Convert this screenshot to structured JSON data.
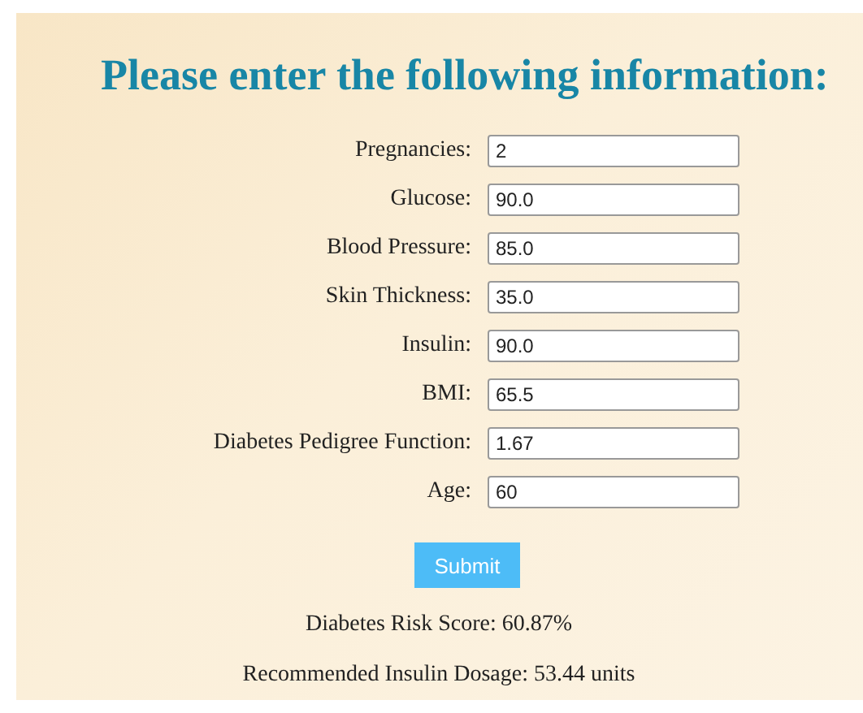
{
  "heading": "Please enter the following information:",
  "fields": [
    {
      "label": "Pregnancies:",
      "value": "2"
    },
    {
      "label": "Glucose:",
      "value": "90.0"
    },
    {
      "label": "Blood Pressure:",
      "value": "85.0"
    },
    {
      "label": "Skin Thickness:",
      "value": "35.0"
    },
    {
      "label": "Insulin:",
      "value": "90.0"
    },
    {
      "label": "BMI:",
      "value": "65.5"
    },
    {
      "label": "Diabetes Pedigree Function:",
      "value": "1.67"
    },
    {
      "label": "Age:",
      "value": "60"
    }
  ],
  "submit": "Submit",
  "results": [
    "Diabetes Risk Score: 60.87%",
    "Recommended Insulin Dosage: 53.44 units"
  ]
}
